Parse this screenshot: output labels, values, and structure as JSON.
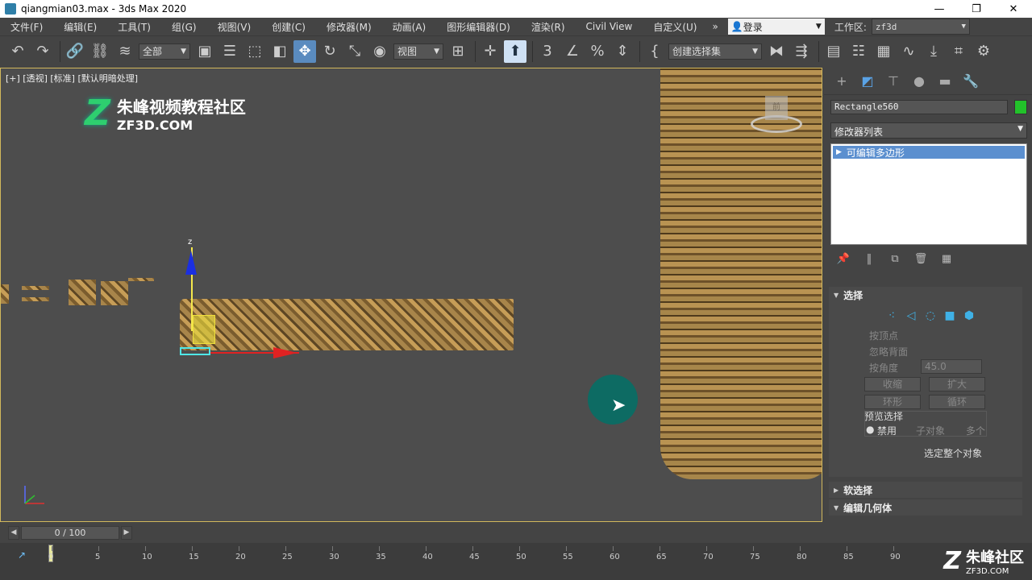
{
  "window": {
    "title": "qiangmian03.max - 3ds Max 2020",
    "min": "—",
    "max": "❐",
    "close": "✕"
  },
  "menu": {
    "items": [
      "文件(F)",
      "编辑(E)",
      "工具(T)",
      "组(G)",
      "视图(V)",
      "创建(C)",
      "修改器(M)",
      "动画(A)",
      "图形编辑器(D)",
      "渲染(R)",
      "Civil View",
      "自定义(U)"
    ],
    "more": "»",
    "login": "登录",
    "workspace_label": "工作区:",
    "workspace_value": "zf3d"
  },
  "toolbar": {
    "filter_value": "全部",
    "refcoord_value": "视图",
    "selset_value": "创建选择集"
  },
  "viewport": {
    "label": "[+] [透视] [标准] [默认明暗处理]",
    "watermark_title": "朱峰视频教程社区",
    "watermark_url": "ZF3D.COM",
    "gizmo_z_label": "z",
    "viewcube_label": "前"
  },
  "command_panel": {
    "object_name": "Rectangle560",
    "object_color": "#22c22a",
    "modifier_list": "修改器列表",
    "stack_item": "可编辑多边形",
    "selection_rollout": {
      "title": "选择",
      "by_vertex": "按顶点",
      "ignore_backfacing": "忽略背面",
      "by_angle": "按角度",
      "angle_value": "45.0",
      "shrink": "收缩",
      "grow": "扩大",
      "ring": "环形",
      "loop": "循环",
      "preview_label": "预览选择",
      "preview_disabled": "禁用",
      "preview_subobject": "子对象",
      "preview_multi": "多个",
      "select_whole": "选定整个对象"
    },
    "soft_selection": "软选择",
    "edit_geometry": "编辑几何体"
  },
  "timeline": {
    "frame_display": "0 / 100",
    "ticks": [
      "0",
      "5",
      "10",
      "15",
      "20",
      "25",
      "30",
      "35",
      "40",
      "45",
      "50",
      "55",
      "60",
      "65",
      "70",
      "75",
      "80",
      "85",
      "90"
    ]
  },
  "brand": {
    "name": "朱峰社区",
    "url": "ZF3D.COM"
  }
}
